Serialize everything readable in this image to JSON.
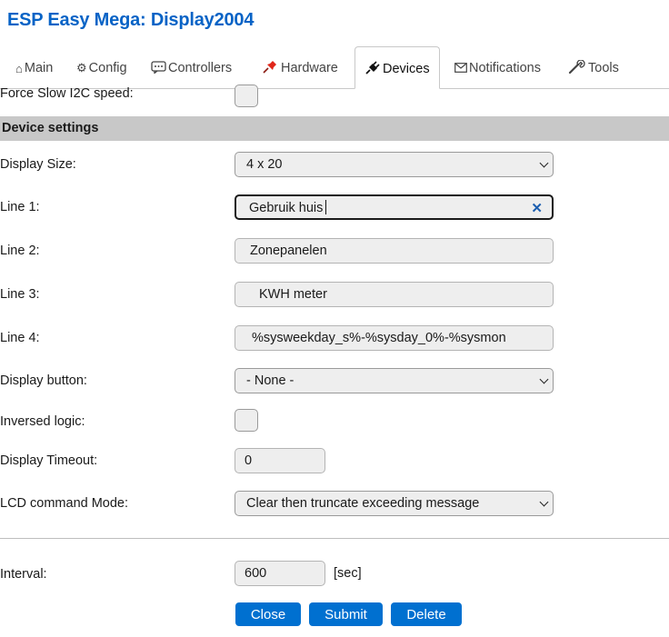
{
  "page_title": "ESP Easy Mega: Display2004",
  "tabs": [
    {
      "label": "Main",
      "icon": "home-icon"
    },
    {
      "label": "Config",
      "icon": "gear-icon"
    },
    {
      "label": "Controllers",
      "icon": "chat-icon"
    },
    {
      "label": "Hardware",
      "icon": "pushpin-icon"
    },
    {
      "label": "Devices",
      "icon": "plug-icon",
      "active": true
    },
    {
      "label": "Notifications",
      "icon": "envelope-icon"
    },
    {
      "label": "Tools",
      "icon": "wrench-icon"
    }
  ],
  "form": {
    "force_slow_i2c_label": "Force Slow I2C speed:",
    "section_title": "Device settings",
    "display_size_label": "Display Size:",
    "display_size_value": "4 x 20",
    "line1_label": "Line 1:",
    "line1_value": "Gebruik huis",
    "line2_label": "Line 2:",
    "line2_value": "Zonepanelen",
    "line3_label": "Line 3:",
    "line3_value": "KWH meter",
    "line4_label": "Line 4:",
    "line4_value": "%sysweekday_s%-%sysday_0%-%sysmon",
    "display_button_label": "Display button:",
    "display_button_value": "- None -",
    "inversed_logic_label": "Inversed logic:",
    "display_timeout_label": "Display Timeout:",
    "display_timeout_value": "0",
    "lcd_mode_label": "LCD command Mode:",
    "lcd_mode_value": "Clear then truncate exceeding message",
    "interval_label": "Interval:",
    "interval_value": "600",
    "interval_unit": "[sec]"
  },
  "buttons": {
    "close": "Close",
    "submit": "Submit",
    "delete": "Delete"
  },
  "colors": {
    "title": "#0763c6",
    "button": "#0070d0",
    "section_bg": "#c8c8c8",
    "hardware_pin": "#e0261a"
  }
}
